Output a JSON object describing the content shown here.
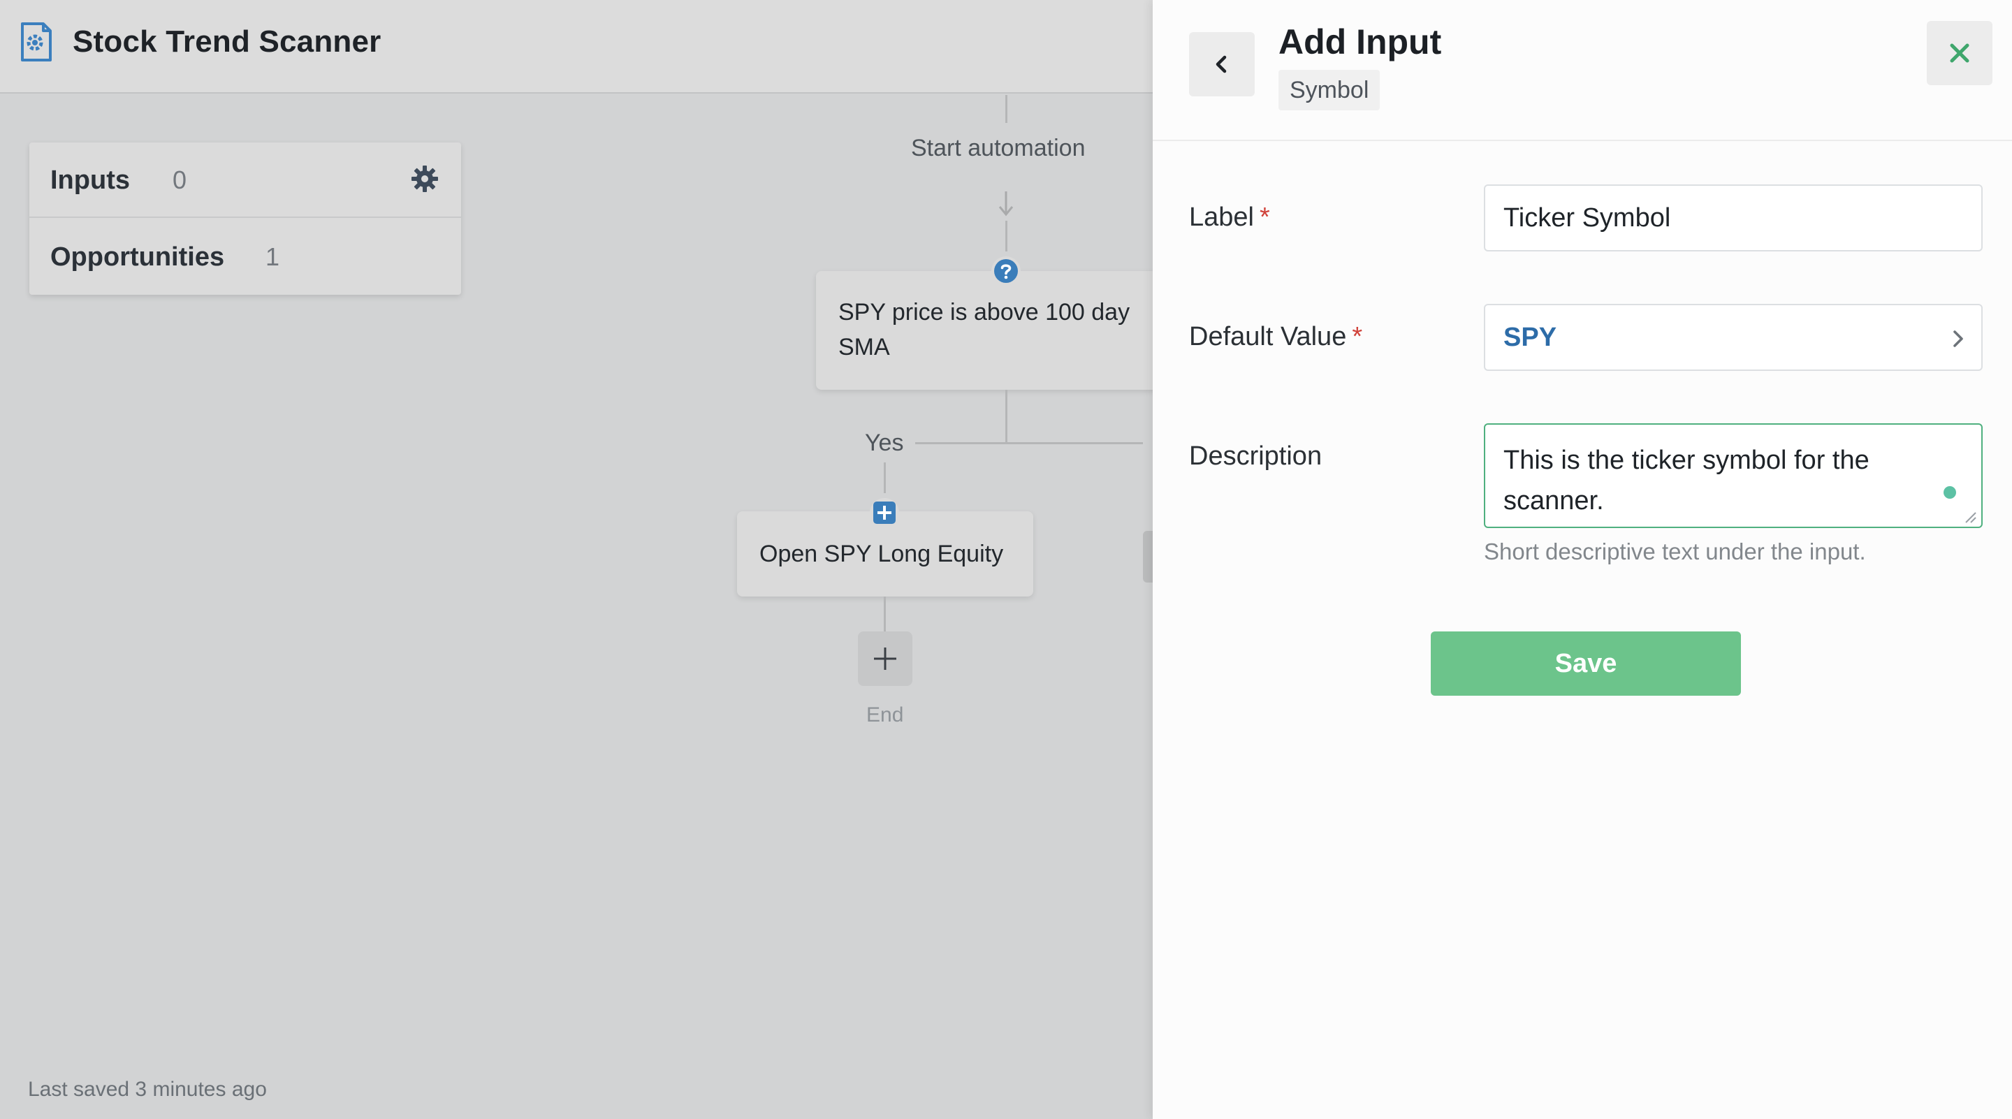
{
  "app": {
    "title": "Stock Trend Scanner",
    "logo_icon": "gear-document-icon",
    "sidebar": {
      "items": [
        {
          "label": "Inputs",
          "count": "0"
        },
        {
          "label": "Opportunities",
          "count": "1"
        }
      ],
      "settings_icon": "gear-icon"
    },
    "flow": {
      "start_label": "Start automation",
      "condition": {
        "icon": "question-icon",
        "text": "SPY price is above 100 day SMA"
      },
      "branch_label": "Yes",
      "action": {
        "icon": "plus-square-icon",
        "text": "Open SPY Long Equity"
      },
      "add_step_icon": "plus-icon",
      "end_label": "End"
    },
    "status": "Last saved 3 minutes ago"
  },
  "panel": {
    "title": "Add Input",
    "subtitle": "Symbol",
    "back_icon": "chevron-left-icon",
    "close_icon": "close-icon",
    "fields": {
      "label": {
        "label": "Label",
        "required": "*",
        "value": "Ticker Symbol"
      },
      "default_value": {
        "label": "Default Value",
        "required": "*",
        "value": "SPY"
      },
      "description": {
        "label": "Description",
        "value": "This is the ticker symbol for the scanner.",
        "help": "Short descriptive text under the input."
      }
    },
    "save_label": "Save"
  },
  "colors": {
    "accent_green": "#6cc48b",
    "close_green": "#3fa66c",
    "link_blue": "#2d6ca8",
    "required_red": "#d0423a",
    "badge_blue": "#3a7dba"
  }
}
